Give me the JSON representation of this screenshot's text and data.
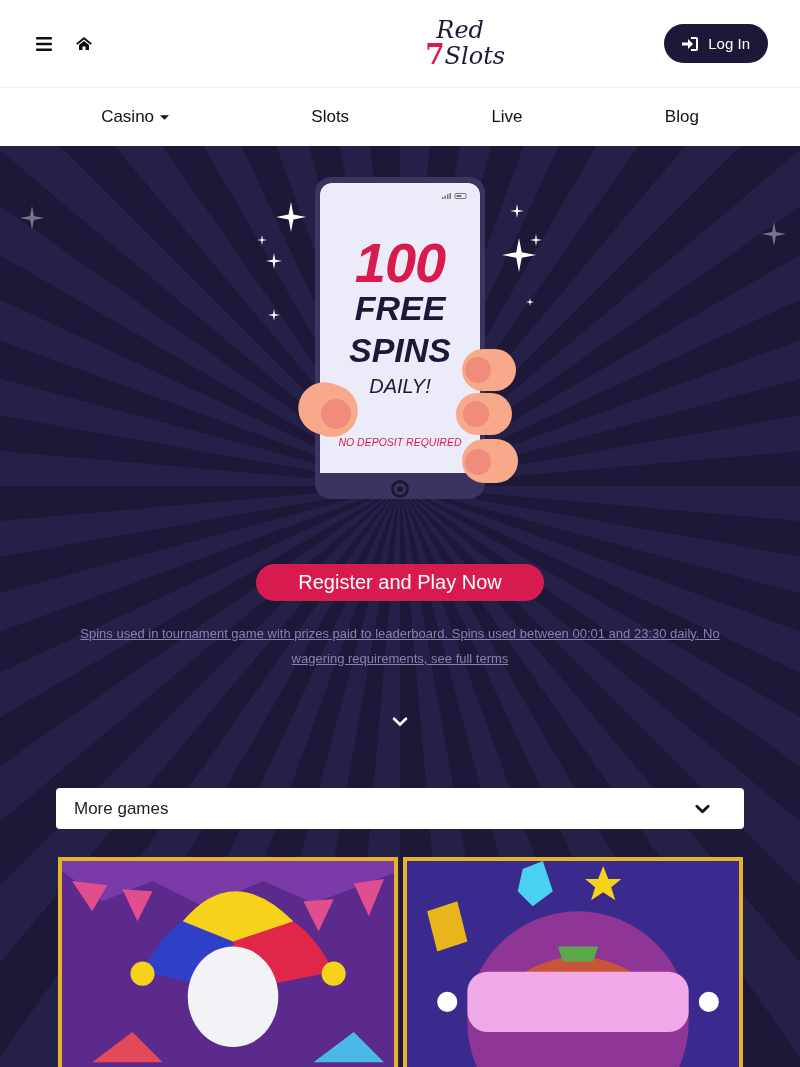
{
  "header": {
    "logo": {
      "line_1": "Red",
      "digit": "7",
      "line_2": "Slots"
    },
    "login_button": "Log In"
  },
  "nav": [
    {
      "label": "Casino",
      "dropdown": true
    },
    {
      "label": "Slots",
      "dropdown": false
    },
    {
      "label": "Live",
      "dropdown": false
    },
    {
      "label": "Blog",
      "dropdown": false
    }
  ],
  "hero": {
    "promo": {
      "amount": "100",
      "line_1": "FREE",
      "line_2": "SPINS",
      "line_3": "DAILY!",
      "note": "NO DEPOSIT REQUIRED"
    },
    "cta_button": "Register and Play Now",
    "terms_link": "Spins used in tournament game with prizes paid to leaderboard. Spins used between 00:01 and 23:30 daily. No wagering requirements, see full terms"
  },
  "games_filter": {
    "label": "More games",
    "expanded": false
  }
}
